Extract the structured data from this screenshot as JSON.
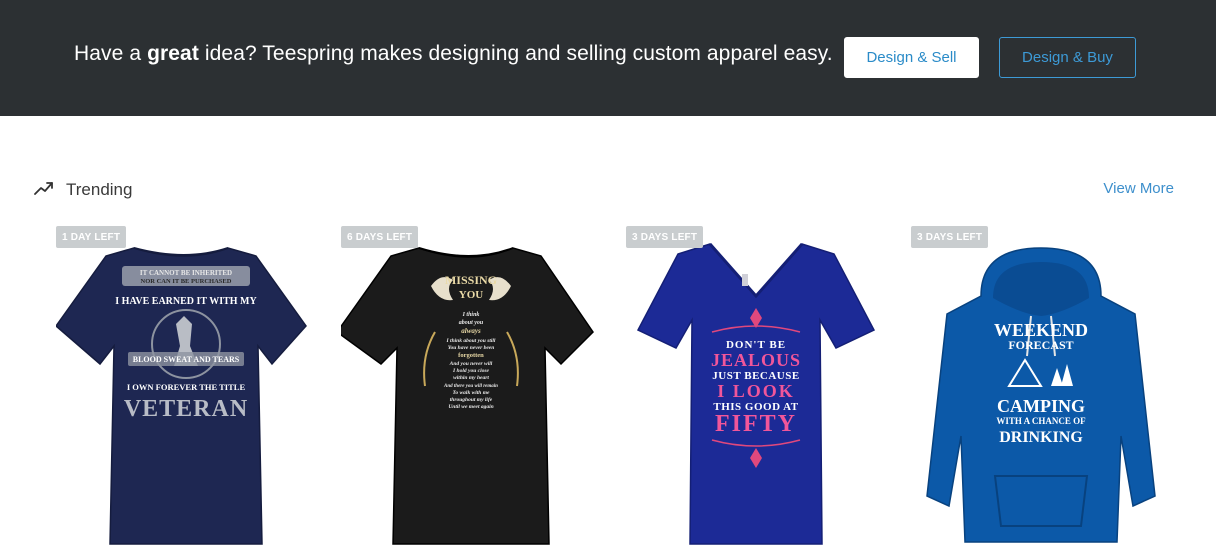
{
  "banner": {
    "text_before": "Have a ",
    "text_bold": "great",
    "text_after": " idea? Teespring makes designing and selling custom apparel easy.",
    "design_sell_label": "Design & Sell",
    "design_buy_label": "Design & Buy"
  },
  "trending": {
    "icon": "trending-up-icon",
    "title": "Trending",
    "view_more_label": "View More"
  },
  "products": [
    {
      "badge": "1 DAY LEFT",
      "garment": "tshirt",
      "color": "#1e2752",
      "lines": [
        "IT CANNOT BE INHERITED",
        "NOR CAN IT BE PURCHASED",
        "I HAVE EARNED IT WITH MY",
        "BLOOD  SWEAT AND  TEARS",
        "I OWN FOREVER THE TITLE",
        "VETERAN"
      ]
    },
    {
      "badge": "6 DAYS LEFT",
      "garment": "tshirt",
      "color": "#1b1b1b",
      "lines": [
        "MISSING",
        "YOU",
        "I think",
        "about you",
        "always",
        "I think about you still",
        "You have never been",
        "forgotten",
        "And you never will",
        "I hold you close",
        "within my heart",
        "And there you will remain",
        "To walk with me",
        "throughout my life",
        "Until we meet again"
      ]
    },
    {
      "badge": "3 DAYS LEFT",
      "garment": "vneck",
      "color": "#1c2a96",
      "lines": [
        "DON'T BE",
        "JEALOUS",
        "JUST BECAUSE",
        "I LOOK",
        "THIS GOOD AT",
        "FIFTY"
      ]
    },
    {
      "badge": "3 DAYS LEFT",
      "garment": "hoodie",
      "color": "#0c59a8",
      "lines": [
        "WEEKEND",
        "FORECAST",
        "CAMPING",
        "WITH A CHANCE OF",
        "DRINKING"
      ]
    }
  ]
}
